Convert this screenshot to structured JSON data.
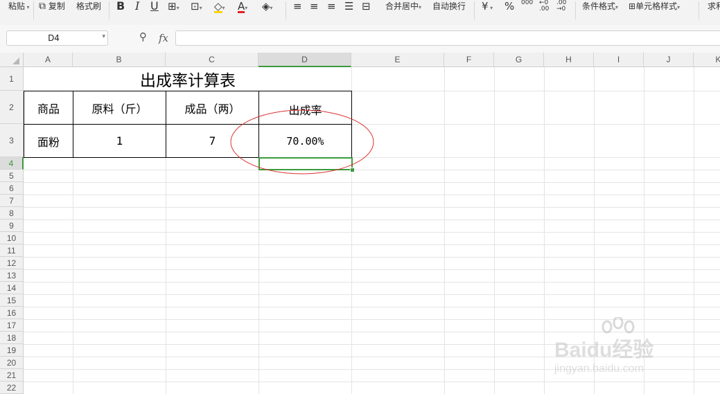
{
  "toolbar": {
    "paste": "粘贴",
    "copy": "复制",
    "format_painter": "格式刷",
    "bold": "B",
    "italic": "I",
    "underline": "U",
    "merge_center": "合并居中",
    "wrap_text": "自动换行",
    "currency": "¥",
    "percent": "%",
    "conditional_format": "条件格式",
    "cell_style": "单元格样式",
    "sum": "求和",
    "font_color": "#e02020",
    "fill_color": "#ffd400"
  },
  "formula_bar": {
    "name_box": "D4",
    "fx_label": "fx",
    "formula": ""
  },
  "columns": [
    "A",
    "B",
    "C",
    "D",
    "E",
    "F",
    "G",
    "H",
    "I",
    "J",
    "K"
  ],
  "rows": [
    "1",
    "2",
    "3",
    "4",
    "5",
    "6",
    "7",
    "8",
    "9",
    "10",
    "11",
    "12",
    "13",
    "14",
    "15",
    "16",
    "17",
    "18",
    "19",
    "20",
    "21",
    "22"
  ],
  "sheet": {
    "title": "出成率计算表",
    "header": {
      "a": "商品",
      "b": "原料（斤）",
      "c": "成品（两）",
      "d": "出成率"
    },
    "data": {
      "a": "面粉",
      "b": "1",
      "c": "7",
      "d": "70.00%"
    }
  },
  "selection": {
    "active_cell": "D4",
    "color": "#3b9a3b"
  },
  "annotation_color": "#d93030",
  "watermark": {
    "brand": "Baidu经验",
    "url": "jingyan.baidu.com"
  }
}
